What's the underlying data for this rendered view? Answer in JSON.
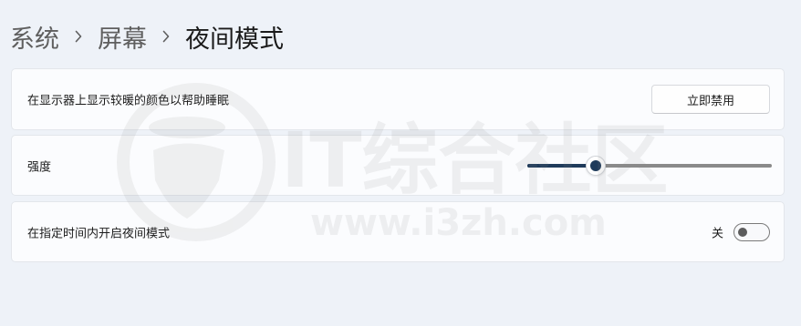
{
  "breadcrumb": {
    "items": [
      "系统",
      "屏幕"
    ],
    "current": "夜间模式",
    "separator_icon": "chevron-right-icon"
  },
  "night_light_card": {
    "label": "在显示器上显示较暖的颜色以帮助睡眠",
    "button_label": "立即禁用"
  },
  "strength_card": {
    "label": "强度",
    "slider_value_fraction": 0.28
  },
  "schedule_card": {
    "label": "在指定时间内开启夜间模式",
    "toggle_state_label": "关",
    "toggle_on": false
  },
  "watermark": {
    "title": "IT综合社区",
    "url": "www.i3zh.com"
  },
  "colors": {
    "background": "#eef2f8",
    "card": "#fbfcfe",
    "accent": "#1f3b5b",
    "text": "#1b1b1b"
  }
}
